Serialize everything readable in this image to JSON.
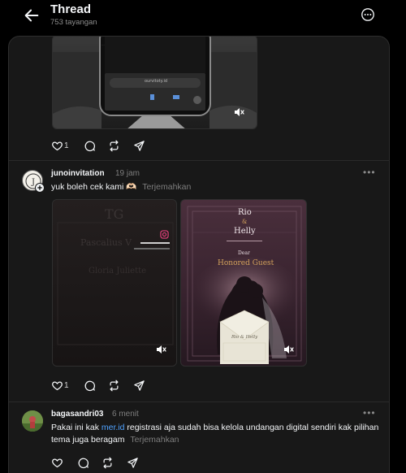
{
  "header": {
    "title": "Thread",
    "views": "753 tayangan"
  },
  "post1": {
    "url_bar": "ourvitoty.id",
    "likes": "1"
  },
  "post2": {
    "username": "junoinvitation",
    "time": "19 jam",
    "text": "yuk boleh cek kami 🫶🏻",
    "translate": "Terjemahkan",
    "likes": "1",
    "media_left": {
      "monogram": "TG",
      "line1": "Pascalius V",
      "line2": "Gloria Juliette"
    },
    "media_right": {
      "name1": "Rio",
      "amp": "&",
      "name2": "Helly",
      "dear": "Dear",
      "guest": "Honored Guest",
      "envelope_text": "Rio & Helly"
    }
  },
  "post3": {
    "username": "bagasandri03",
    "time": "6 menit",
    "text_before": "Pakai ini kak ",
    "link": "mer.id",
    "text_after": " registrasi aja sudah bisa kelola undangan digital sendiri kak pilihan tema juga beragam",
    "translate": "Terjemahkan"
  },
  "icons": {
    "back": "arrow-left-icon",
    "more": "more-circle-icon",
    "like": "heart-icon",
    "comment": "comment-icon",
    "repost": "repost-icon",
    "share": "share-icon",
    "mute": "speaker-muted-icon"
  }
}
